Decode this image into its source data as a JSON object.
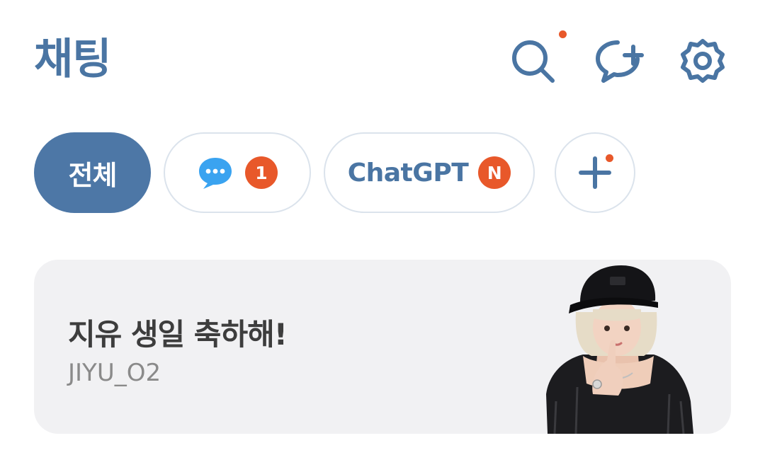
{
  "header": {
    "title": "채팅",
    "icons": [
      "search-icon",
      "new-chat-icon",
      "settings-icon"
    ],
    "accent": "#4a75a3",
    "notification_color": "#e8582a"
  },
  "filters": {
    "all_label": "전체",
    "messages": {
      "icon": "chat-bubble-icon",
      "badge": "1"
    },
    "chatgpt": {
      "label": "ChatGPT",
      "badge": "N"
    },
    "add": {
      "icon": "plus-icon"
    }
  },
  "banner": {
    "title": "지유 생일 축하해!",
    "subtitle": "JIYU_O2",
    "image": "person-portrait-black-cap"
  }
}
